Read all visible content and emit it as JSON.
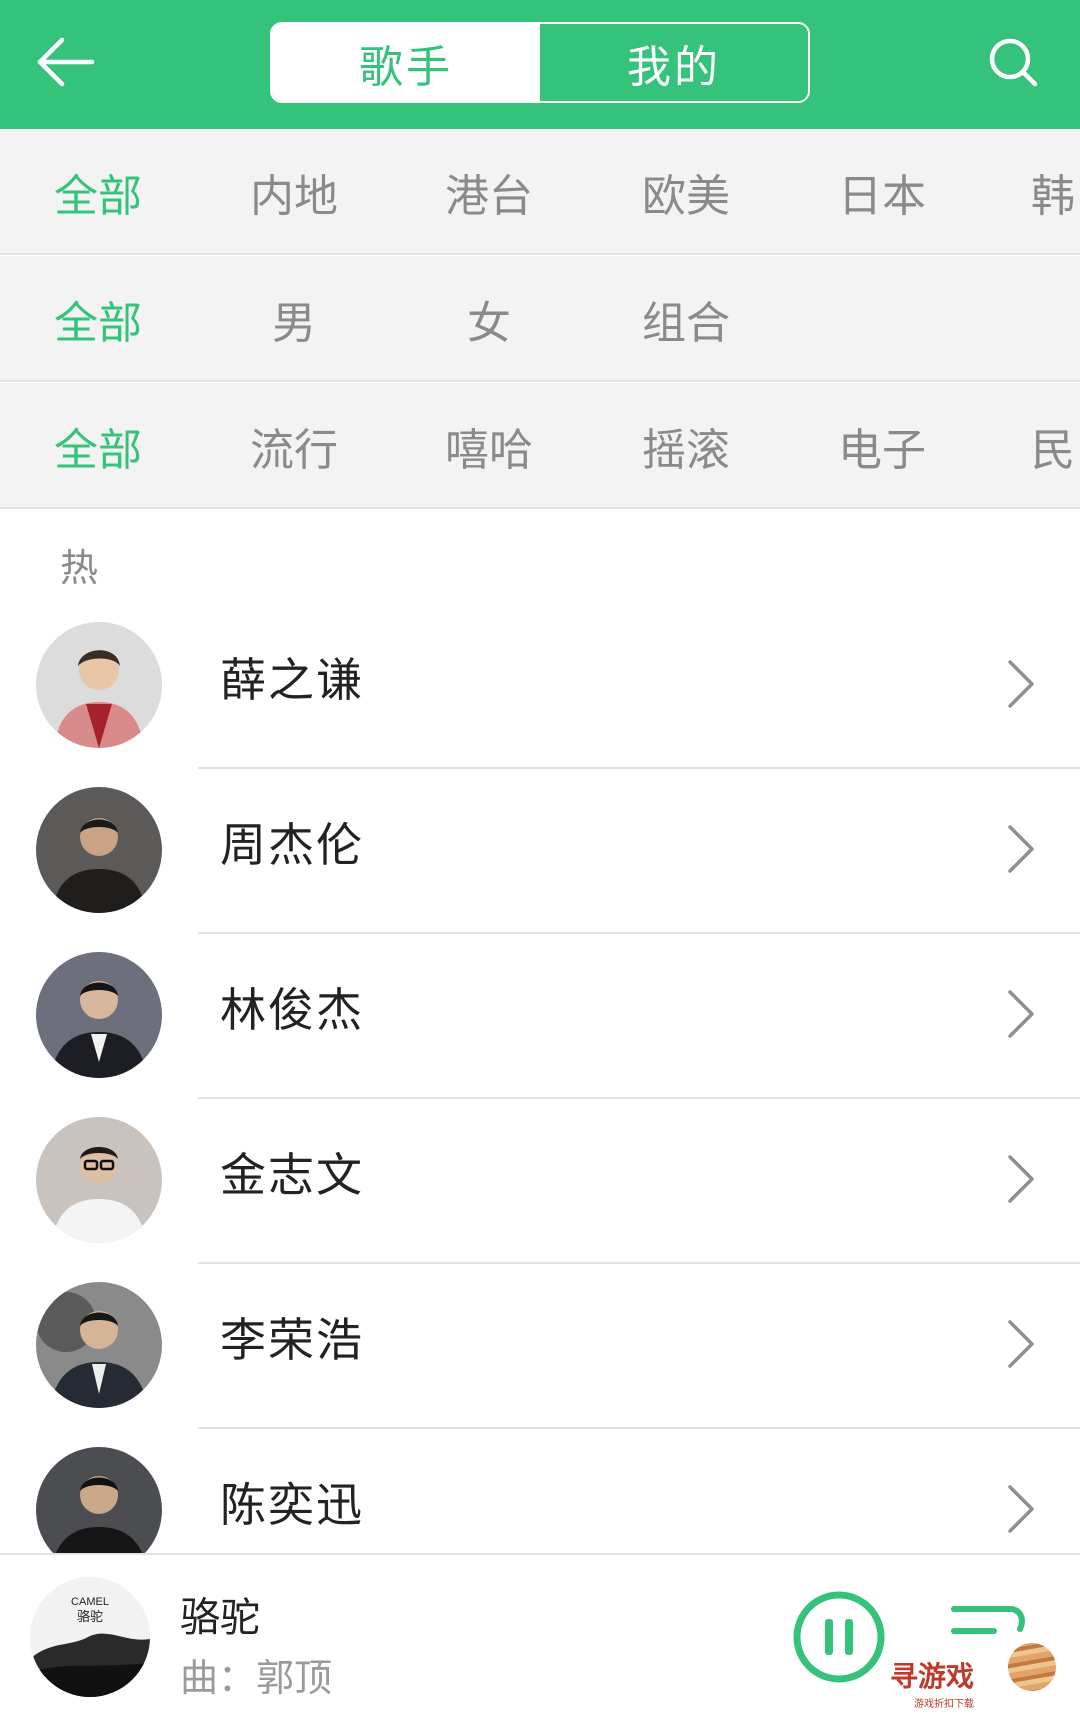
{
  "header": {
    "tabs": [
      {
        "label": "歌手",
        "active": true
      },
      {
        "label": "我的",
        "active": false
      }
    ],
    "back_icon": "arrow-left-icon",
    "search_icon": "search-icon"
  },
  "filters": {
    "region": [
      "全部",
      "内地",
      "港台",
      "欧美",
      "日本",
      "韩"
    ],
    "gender": [
      "全部",
      "男",
      "女",
      "组合"
    ],
    "genre": [
      "全部",
      "流行",
      "嘻哈",
      "摇滚",
      "电子",
      "民"
    ]
  },
  "section_label": "热",
  "artists": [
    {
      "name": "薛之谦"
    },
    {
      "name": "周杰伦"
    },
    {
      "name": "林俊杰"
    },
    {
      "name": "金志文"
    },
    {
      "name": "李荣浩"
    },
    {
      "name": "陈奕迅"
    }
  ],
  "player": {
    "title": "骆驼",
    "subtitle": "曲：郭顶",
    "album_text_top": "CAMEL",
    "album_text_main": "骆驼"
  },
  "watermark": {
    "text": "寻游戏",
    "sub": "游戏折扣下载"
  },
  "colors": {
    "accent": "#35c37c",
    "chip_inactive": "#8a8a8a",
    "filter_bg": "#f3f3f3"
  }
}
